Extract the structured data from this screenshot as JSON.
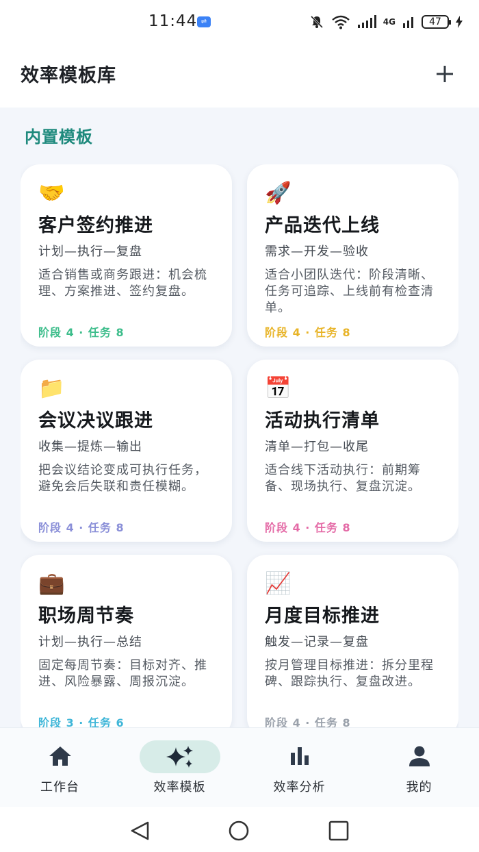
{
  "status": {
    "time": "11:44",
    "net_label": "4G",
    "battery": "47"
  },
  "app_bar": {
    "title": "效率模板库"
  },
  "section": {
    "title": "内置模板"
  },
  "templates": [
    {
      "emoji": "🤝",
      "title": "客户签约推进",
      "flow": "计划—执行—复盘",
      "desc": "适合销售或商务跟进：机会梳理、方案推进、签约复盘。",
      "meta": "阶段 4 · 任务 8",
      "accent": "#3dbd8b"
    },
    {
      "emoji": "🚀",
      "title": "产品迭代上线",
      "flow": "需求—开发—验收",
      "desc": "适合小团队迭代：阶段清晰、任务可追踪、上线前有检查清单。",
      "meta": "阶段 4 · 任务 8",
      "accent": "#e8b428"
    },
    {
      "emoji": "📁",
      "title": "会议决议跟进",
      "flow": "收集—提炼—输出",
      "desc": "把会议结论变成可执行任务，避免会后失联和责任模糊。",
      "meta": "阶段 4 · 任务 8",
      "accent": "#8a8fd8"
    },
    {
      "emoji": "📅",
      "title": "活动执行清单",
      "flow": "清单—打包—收尾",
      "desc": "适合线下活动执行：前期筹备、现场执行、复盘沉淀。",
      "meta": "阶段 4 · 任务 8",
      "accent": "#e46aa6"
    },
    {
      "emoji": "💼",
      "title": "职场周节奏",
      "flow": "计划—执行—总结",
      "desc": "固定每周节奏：目标对齐、推进、风险暴露、周报沉淀。",
      "meta": "阶段 3 · 任务 6",
      "accent": "#3fb6d8"
    },
    {
      "emoji": "📈",
      "title": "月度目标推进",
      "flow": "触发—记录—复盘",
      "desc": "按月管理目标推进：拆分里程碑、跟踪执行、复盘改进。",
      "meta": "阶段 4 · 任务 8",
      "accent": "#9aa1ab"
    }
  ],
  "nav": [
    {
      "label": "工作台",
      "icon": "home-icon"
    },
    {
      "label": "效率模板",
      "icon": "sparkle-icon",
      "active": true
    },
    {
      "label": "效率分析",
      "icon": "bar-chart-icon"
    },
    {
      "label": "我的",
      "icon": "person-icon"
    }
  ],
  "colors": {
    "accent_teal": "#1f8a7d",
    "active_pill": "#d7ece8"
  }
}
